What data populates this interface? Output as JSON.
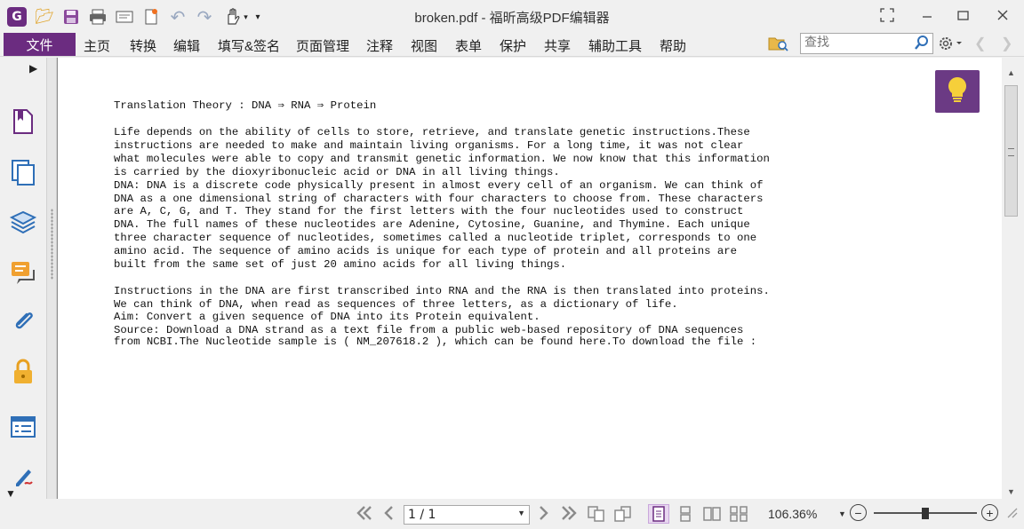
{
  "window": {
    "title": "broken.pdf - 福昕高级PDF编辑器",
    "buttons": [
      "restore-layout",
      "minimize",
      "maximize",
      "close"
    ]
  },
  "quick_access": {
    "icons": [
      "app-logo-icon",
      "open-folder-icon",
      "save-icon",
      "print-icon",
      "scan-icon",
      "new-doc-icon",
      "undo-icon",
      "redo-icon",
      "hand-tool-icon"
    ]
  },
  "menu": {
    "file_label": "文件",
    "items": [
      "主页",
      "转换",
      "编辑",
      "填写&签名",
      "页面管理",
      "注释",
      "视图",
      "表单",
      "保护",
      "共享",
      "辅助工具",
      "帮助"
    ]
  },
  "search": {
    "placeholder": "查找"
  },
  "sidebar": {
    "icons": [
      "bookmarks-icon",
      "pages-icon",
      "layers-icon",
      "comments-icon",
      "attachments-icon",
      "security-icon",
      "properties-icon",
      "signatures-icon"
    ]
  },
  "document": {
    "lines": [
      "Translation Theory : DNA ⇒ RNA ⇒ Protein",
      "Life depends on the ability of cells to store, retrieve, and translate genetic instructions.These",
      "instructions are needed to make and maintain living organisms. For a long time, it was not clear",
      "what molecules were able to copy and transmit genetic information. We now know that this information",
      "is carried by the dioxyribonucleic acid or DNA in all living things.",
      "DNA: DNA is a discrete code physically present in almost every cell of an organism. We can think of",
      "DNA as a one dimensional string of characters with four characters to choose from. These characters",
      "are A, C, G, and T. They stand for the first letters with the four nucleotides used to construct",
      "DNA. The full names of these nucleotides are Adenine, Cytosine, Guanine, and Thymine. Each unique",
      "three character sequence of nucleotides, sometimes called a nucleotide triplet, corresponds to one",
      "amino acid. The sequence of amino acids is unique for each type of protein and all proteins are",
      "built from the same set of just 20 amino acids for all living things.",
      "Instructions in the DNA are first transcribed into RNA and the RNA is then translated into proteins.",
      "We can think of DNA, when read as sequences of three letters, as a dictionary of life.",
      "Aim: Convert a given sequence of DNA into its Protein equivalent.",
      "Source: Download a DNA strand as a text file from a public web-based repository of DNA sequences",
      "from NCBI.The Nucleotide sample is ( NM_207618.2 ), which can be found here.To download the file :"
    ]
  },
  "status": {
    "page_value": "1 / 1",
    "zoom": "106.36%",
    "zoom_level": 0.47
  },
  "colors": {
    "accent": "#6b2c80",
    "tip_button": "#6b3a84"
  }
}
